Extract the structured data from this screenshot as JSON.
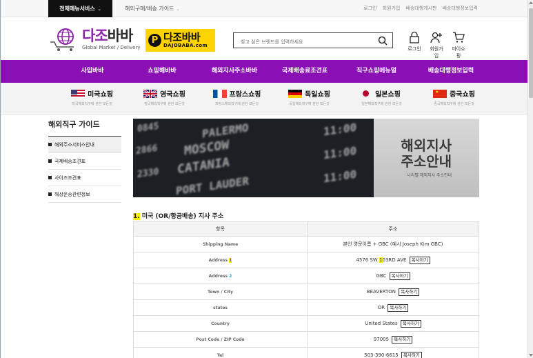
{
  "topbar": {
    "all_services": "전체메뉴서비스",
    "guide": "해외구매/배송 가이드",
    "links": [
      "로그인",
      "회원가입",
      "배송대행게시판",
      "배송대행정보입력"
    ]
  },
  "header": {
    "logo_ko_main": "다조",
    "logo_ko_sub": "바바",
    "logo_en": "Global Market / Delivery",
    "yellow_logo_p": "P",
    "yellow_logo_ko": "다조바바",
    "yellow_logo_domain": "DAJOBABA.com",
    "search_placeholder": "찾고 싶은 브랜드를 입력하세요",
    "icons": [
      {
        "label": "로그인",
        "icon": "lock-icon"
      },
      {
        "label": "회원가입",
        "icon": "add-user-icon"
      },
      {
        "label": "마이쇼핑",
        "icon": "cart-icon"
      }
    ]
  },
  "purple_nav": [
    "사입바바",
    "쇼핑해바바",
    "해외지사주소바바",
    "국제배송료조견표",
    "직구쇼핑메뉴얼",
    "배송대행정보입력"
  ],
  "country_nav": [
    {
      "name": "미국쇼핑",
      "sub": "미국해외직구에 관한 모든것",
      "flag": "us"
    },
    {
      "name": "영국쇼핑",
      "sub": "영국해외직구에 관한 모든것",
      "flag": "uk"
    },
    {
      "name": "프랑스쇼핑",
      "sub": "프랑스해외직구에 관한 모든것",
      "flag": "fr"
    },
    {
      "name": "독일쇼핑",
      "sub": "독일해외직구에 관한 모든것",
      "flag": "de"
    },
    {
      "name": "일본쇼핑",
      "sub": "일본해외직구에 관한 모든것",
      "flag": "jp"
    },
    {
      "name": "중국쇼핑",
      "sub": "중국해외직구에 관한 모든것",
      "flag": "cn"
    }
  ],
  "sidebar": {
    "title": "해외직구 가이드",
    "items": [
      "해외주소서비스안내",
      "국제배송조견표",
      "사이즈조견표",
      "해상운송관련정보"
    ]
  },
  "banner": {
    "title_line1": "해외지사",
    "title_line2": "주소안내",
    "subtitle": "나라별 해외지사 주소안내",
    "board_words": [
      "MOSCOW",
      "CATANIA",
      "PORT LAUDER",
      "PALERMO"
    ],
    "board_times": [
      "0845",
      "2866",
      "2330",
      "11:00",
      "11:00",
      "11:00"
    ]
  },
  "section": {
    "number": "1.",
    "title": " 미국 (OR/항공배송) 지사 주소"
  },
  "table": {
    "headers": [
      "항목",
      "주소"
    ],
    "copy_label": "복사하기",
    "rows": [
      {
        "label": "Shipping Name",
        "value": "본인 영문이름 + GBC (예시 Joseph Kim GBC)",
        "copy": false
      },
      {
        "label_pre": "Address ",
        "label_hl": "1",
        "value_pre": "4576 SW ",
        "value_hl": "1",
        "value_post": "03RD AVE",
        "copy": true
      },
      {
        "label_pre": "Address ",
        "label_hl": "2",
        "value": "GBC",
        "copy": true
      },
      {
        "label": "Town / City",
        "value": "BEAVERTON",
        "copy": true
      },
      {
        "label": "states",
        "value": "OR",
        "copy": true
      },
      {
        "label": "Country",
        "value": "United States",
        "copy": true
      },
      {
        "label": "Post Code / ZIP Code",
        "value": "97005",
        "copy": true
      },
      {
        "label": "Tel",
        "value": "503-390-6615",
        "copy": true
      }
    ]
  },
  "colors": {
    "brand_purple": "#8a0fb5",
    "logo_yellow": "#ffd400",
    "highlight": "#fff200"
  }
}
